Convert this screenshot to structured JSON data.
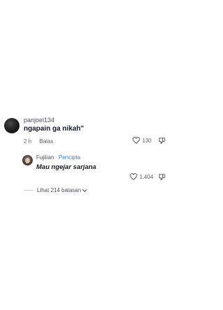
{
  "comment": {
    "username": "panjoel134",
    "text": "ngapain ga nikah\"",
    "time": "2 h",
    "reply_label": "Balas",
    "like_count": "130"
  },
  "reply": {
    "username": "Fujiiian",
    "badge": "Pencipta",
    "text": "Mau ngejar sarjana",
    "like_count": "1.404"
  },
  "view_replies": {
    "label": "Lihat 214 balasan"
  },
  "colors": {
    "creator_badge": "#2b7dd6",
    "text_primary": "#161823",
    "text_secondary": "#5d5f67"
  }
}
